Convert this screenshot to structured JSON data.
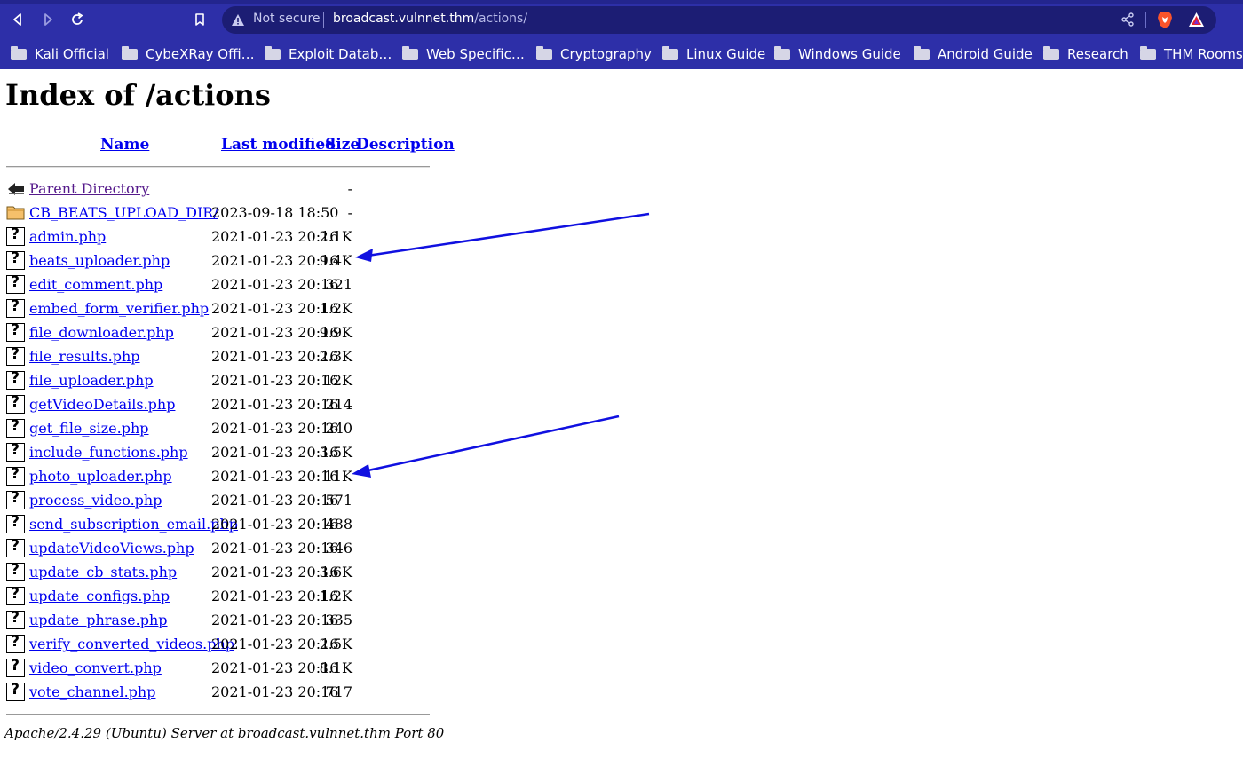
{
  "browser": {
    "security_label": "Not secure",
    "url_host": "broadcast.vulnnet.thm",
    "url_path": "/actions/",
    "bookmarks": [
      "Kali Official",
      "CybeXRay Offi…",
      "Exploit Datab…",
      "Web Specific…",
      "Cryptography",
      "Linux Guide",
      "Windows Guide",
      "Android Guide",
      "Research",
      "THM Rooms"
    ],
    "icons": [
      "back-icon",
      "forward-icon",
      "reload-icon",
      "bookmark-icon",
      "warning-icon",
      "share-icon",
      "brave-shield-icon",
      "brave-rewards-icon"
    ]
  },
  "page": {
    "title": "Index of /actions",
    "columns": {
      "name": "Name",
      "last_modified": "Last modified",
      "size": "Size",
      "description": "Description"
    },
    "entries": [
      {
        "name": "Parent Directory",
        "date": "",
        "size": "-",
        "icon": "back-icon"
      },
      {
        "name": "CB_BEATS_UPLOAD_DIR/",
        "date": "2023-09-18 18:50",
        "size": "-",
        "icon": "folder-icon"
      },
      {
        "name": "admin.php",
        "date": "2021-01-23 20:16",
        "size": "2.1K",
        "icon": "unknown-file-icon"
      },
      {
        "name": "beats_uploader.php",
        "date": "2021-01-23 20:16",
        "size": "9.4K",
        "icon": "unknown-file-icon"
      },
      {
        "name": "edit_comment.php",
        "date": "2021-01-23 20:16",
        "size": "321",
        "icon": "unknown-file-icon"
      },
      {
        "name": "embed_form_verifier.php",
        "date": "2021-01-23 20:16",
        "size": "1.2K",
        "icon": "unknown-file-icon"
      },
      {
        "name": "file_downloader.php",
        "date": "2021-01-23 20:16",
        "size": "9.9K",
        "icon": "unknown-file-icon"
      },
      {
        "name": "file_results.php",
        "date": "2021-01-23 20:16",
        "size": "2.3K",
        "icon": "unknown-file-icon"
      },
      {
        "name": "file_uploader.php",
        "date": "2021-01-23 20:16",
        "size": "12K",
        "icon": "unknown-file-icon"
      },
      {
        "name": "getVideoDetails.php",
        "date": "2021-01-23 20:16",
        "size": "214",
        "icon": "unknown-file-icon"
      },
      {
        "name": "get_file_size.php",
        "date": "2021-01-23 20:16",
        "size": "240",
        "icon": "unknown-file-icon"
      },
      {
        "name": "include_functions.php",
        "date": "2021-01-23 20:16",
        "size": "3.5K",
        "icon": "unknown-file-icon"
      },
      {
        "name": "photo_uploader.php",
        "date": "2021-01-23 20:16",
        "size": "11K",
        "icon": "unknown-file-icon"
      },
      {
        "name": "process_video.php",
        "date": "2021-01-23 20:16",
        "size": "571",
        "icon": "unknown-file-icon"
      },
      {
        "name": "send_subscription_email.php",
        "date": "2021-01-23 20:16",
        "size": "488",
        "icon": "unknown-file-icon"
      },
      {
        "name": "updateVideoViews.php",
        "date": "2021-01-23 20:16",
        "size": "346",
        "icon": "unknown-file-icon"
      },
      {
        "name": "update_cb_stats.php",
        "date": "2021-01-23 20:16",
        "size": "3.6K",
        "icon": "unknown-file-icon"
      },
      {
        "name": "update_configs.php",
        "date": "2021-01-23 20:16",
        "size": "1.2K",
        "icon": "unknown-file-icon"
      },
      {
        "name": "update_phrase.php",
        "date": "2021-01-23 20:16",
        "size": "335",
        "icon": "unknown-file-icon"
      },
      {
        "name": "verify_converted_videos.php",
        "date": "2021-01-23 20:16",
        "size": "2.5K",
        "icon": "unknown-file-icon"
      },
      {
        "name": "video_convert.php",
        "date": "2021-01-23 20:16",
        "size": "8.1K",
        "icon": "unknown-file-icon"
      },
      {
        "name": "vote_channel.php",
        "date": "2021-01-23 20:16",
        "size": "717",
        "icon": "unknown-file-icon"
      }
    ],
    "footer": "Apache/2.4.29 (Ubuntu) Server at broadcast.vulnnet.thm Port 80"
  },
  "annotations": {
    "arrow_color": "#1010e0",
    "arrow_targets": [
      "beats_uploader.php",
      "photo_uploader.php"
    ]
  }
}
